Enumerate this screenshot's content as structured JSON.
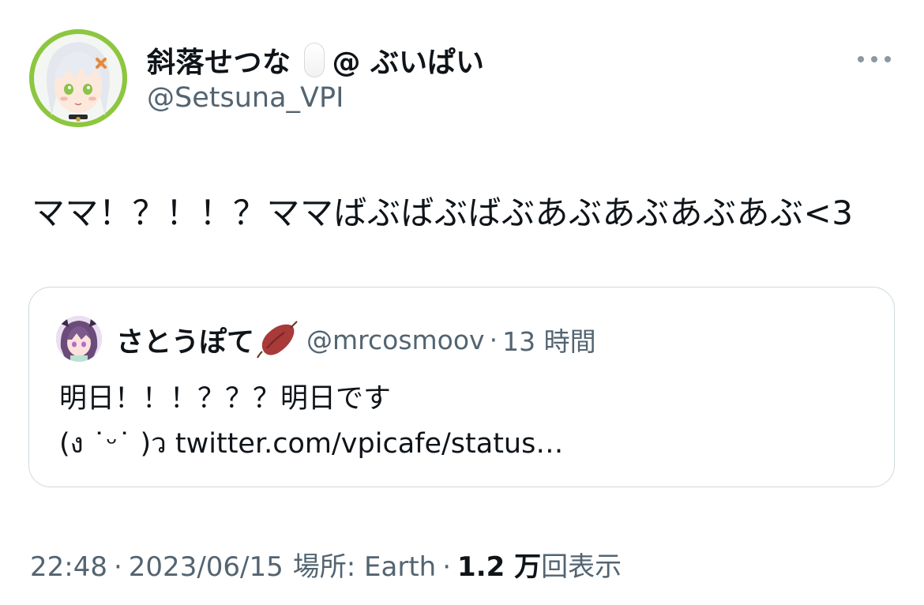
{
  "author": {
    "display_name": "斜落せつな",
    "display_name_suffix": "@ ぶいぱい",
    "handle": "@Setsuna_VPI",
    "avatar_icon": "avatar-image",
    "badge_icon": "white-pill-emoji"
  },
  "more_icon": "more-options-icon",
  "tweet": {
    "text": "ママ！？！！？ママばぶばぶばぶあぶあぶあぶあぶ<3"
  },
  "quote": {
    "display_name": "さとうぽて",
    "name_emoji": "sweet-potato-emoji",
    "handle": "@mrcosmoov",
    "separator": "·",
    "time": "13 時間",
    "line1": "明日！！！？？？明日です",
    "line2": "(ง ˙ᵕ˙ )ว twitter.com/vpicafe/status…"
  },
  "meta": {
    "time": "22:48",
    "separator": "·",
    "date": "2023/06/15",
    "location": "場所: Earth",
    "views_count": "1.2 万",
    "views_label": "回表示"
  },
  "colors": {
    "text_primary": "#0f1419",
    "text_secondary": "#536471",
    "border": "#cfd9de",
    "avatar_ring": "#8dc63f"
  }
}
